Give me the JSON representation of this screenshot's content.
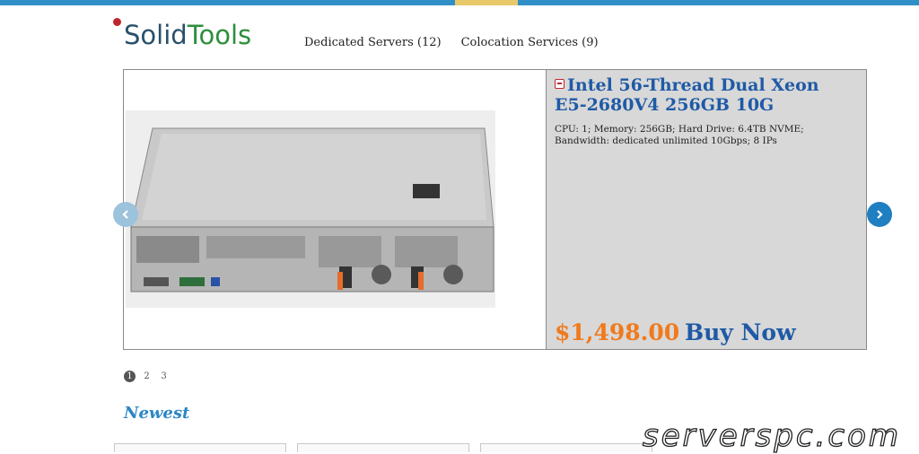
{
  "brand": {
    "logo_part1": "Solid",
    "logo_part2": "Tools"
  },
  "nav": {
    "items": [
      {
        "label": "Dedicated Servers (12)"
      },
      {
        "label": "Colocation Services (9)"
      }
    ]
  },
  "slider": {
    "title": "Intel 56-Thread Dual Xeon E5-2680V4 256GB 10G",
    "description": "CPU: 1; Memory: 256GB; Hard Drive: 6.4TB NVME; Bandwidth: dedicated unlimited 10Gbps; 8 IPs",
    "price": "$1,498.00",
    "buy_label": "Buy Now",
    "pages": [
      "1",
      "2",
      "3"
    ],
    "active_page": 1
  },
  "section": {
    "newest_heading": "Newest"
  },
  "watermark": "serverspc.com",
  "colors": {
    "accent": "#1f5aa6",
    "price": "#f07a1c",
    "topbar": "#2f8fc6",
    "logo_dot": "#c0262d"
  },
  "icons": {
    "prev": "chevron-left-icon",
    "next": "chevron-right-icon",
    "title_badge": "tag-icon"
  }
}
